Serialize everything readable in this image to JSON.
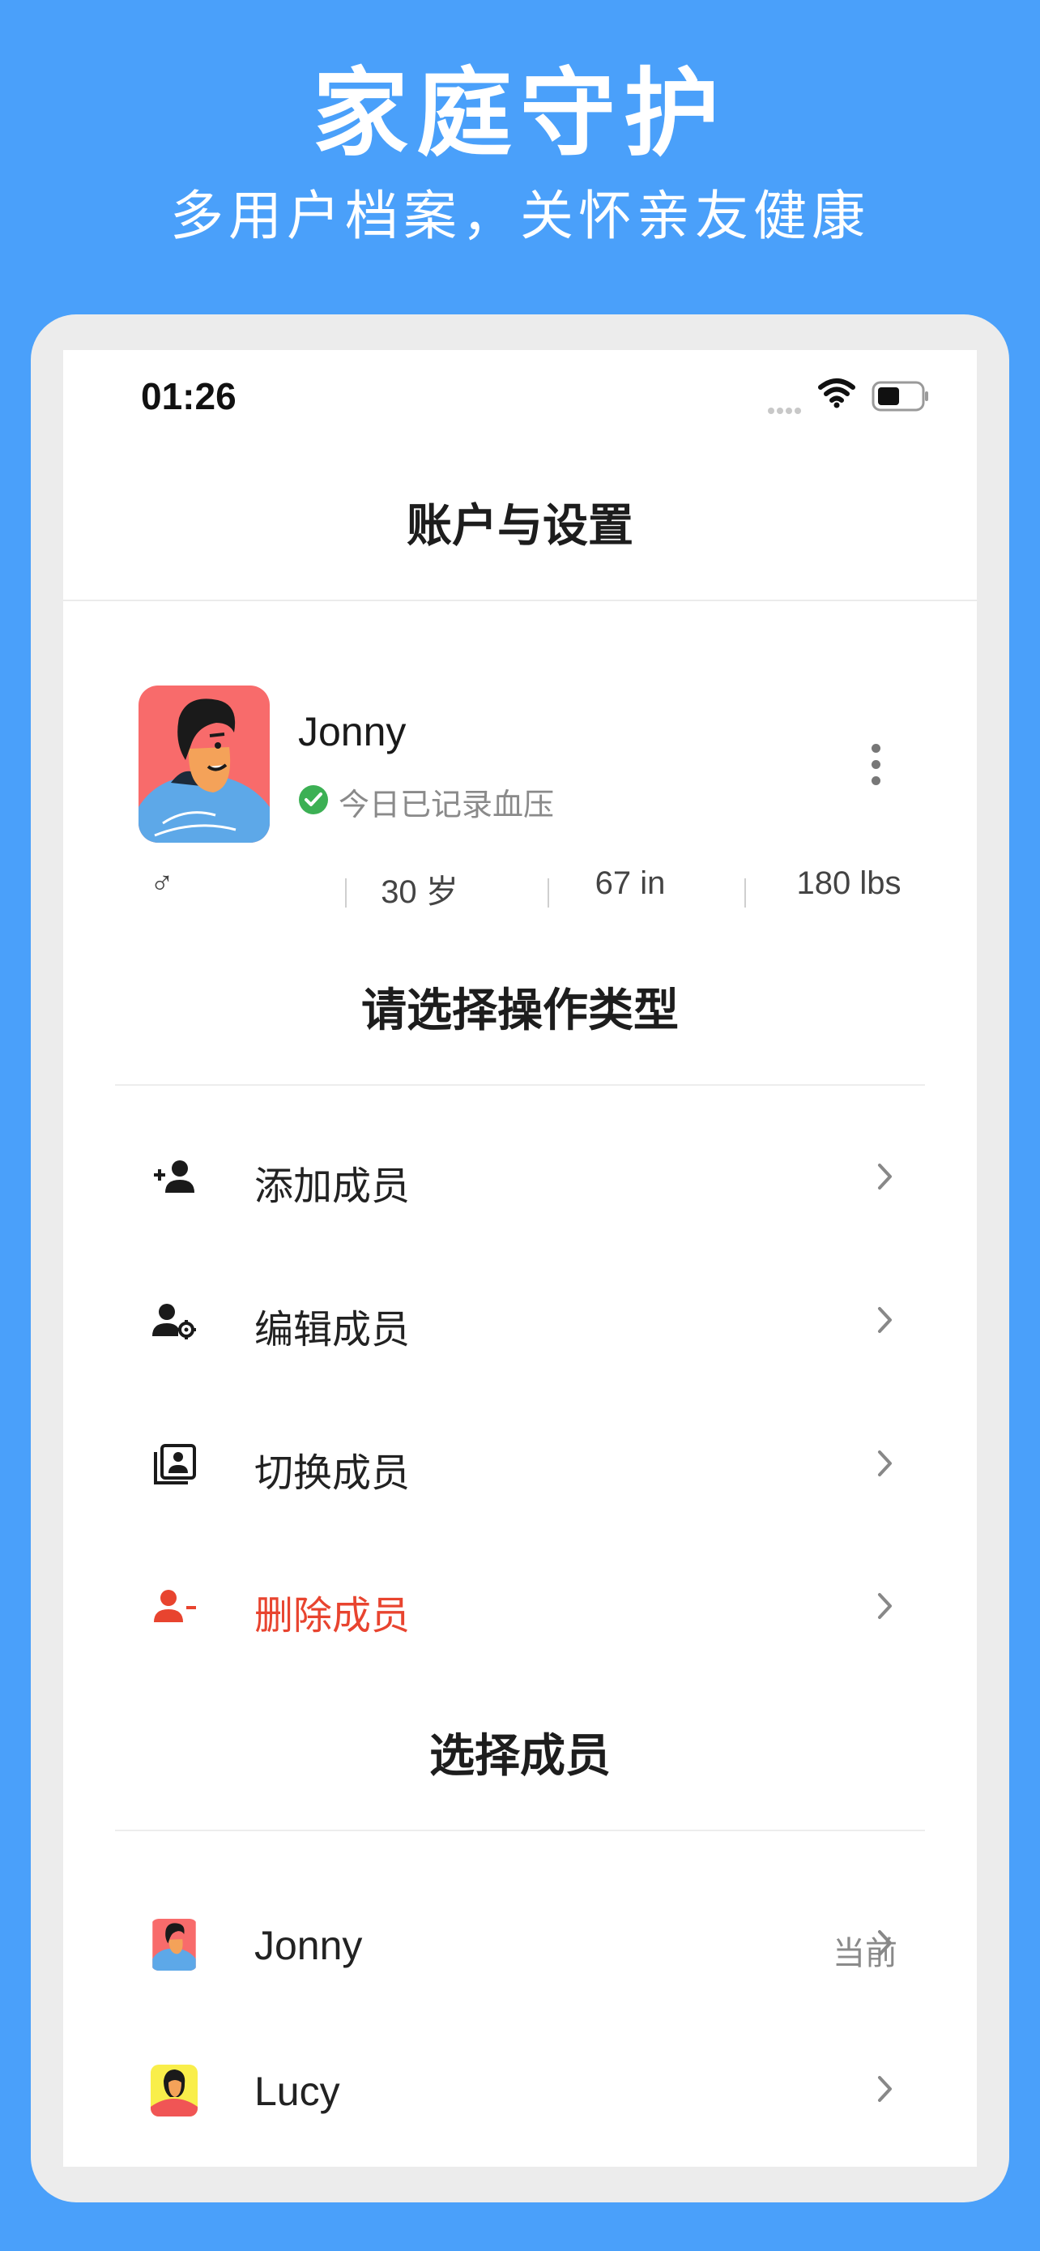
{
  "promo": {
    "title": "家庭守护",
    "subtitle": "多用户档案，关怀亲友健康"
  },
  "status_bar": {
    "time": "01:26"
  },
  "nav": {
    "title": "账户与设置"
  },
  "profile": {
    "name": "Jonny",
    "status": "今日已记录血压",
    "gender_symbol": "♂",
    "age": "30 岁",
    "height": "67 in",
    "weight": "180 lbs"
  },
  "actions": {
    "title": "请选择操作类型",
    "items": [
      {
        "label": "添加成员",
        "icon": "add-person-icon"
      },
      {
        "label": "编辑成员",
        "icon": "person-settings-icon"
      },
      {
        "label": "切换成员",
        "icon": "contacts-book-icon"
      },
      {
        "label": "删除成员",
        "icon": "remove-person-icon"
      }
    ]
  },
  "members": {
    "title": "选择成员",
    "items": [
      {
        "name": "Jonny",
        "badge": "当前"
      },
      {
        "name": "Lucy",
        "badge": ""
      }
    ]
  },
  "colors": {
    "background": "#4aa0fa",
    "danger": "#e8442f",
    "success": "#3cb054"
  }
}
